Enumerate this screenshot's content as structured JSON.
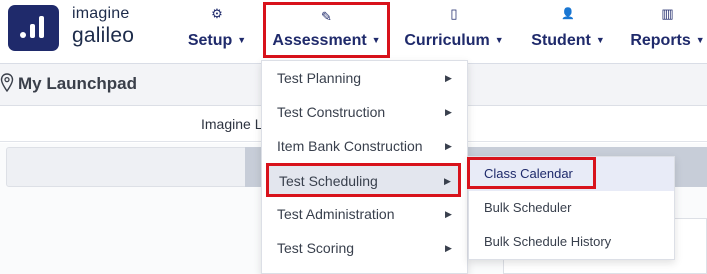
{
  "brand": {
    "line1": "imagine",
    "line2": "galileo",
    "logo_icon": "galileo-logo-icon",
    "logo_color": "#1f2a6b"
  },
  "nav": [
    {
      "label": "Setup",
      "icon": "gear-icon",
      "glyph": "⚙",
      "highlighted": false
    },
    {
      "label": "Assessment",
      "icon": "pencil-edit-icon",
      "glyph": "✎",
      "highlighted": true
    },
    {
      "label": "Curriculum",
      "icon": "book-icon",
      "glyph": "▯",
      "highlighted": false
    },
    {
      "label": "Student",
      "icon": "person-icon",
      "glyph": "👤",
      "highlighted": false
    },
    {
      "label": "Reports",
      "icon": "bar-chart-icon",
      "glyph": "▥",
      "highlighted": false
    }
  ],
  "caret_glyph": "▼",
  "launchpad": {
    "title": "My Launchpad",
    "icon": "map-pin-icon"
  },
  "subtab": {
    "label": "Imagine L"
  },
  "assessment_menu": [
    {
      "label": "Test Planning",
      "has_submenu": true,
      "active": false
    },
    {
      "label": "Test Construction",
      "has_submenu": true,
      "active": false
    },
    {
      "label": "Item Bank Construction",
      "has_submenu": true,
      "active": false
    },
    {
      "label": "Test Scheduling",
      "has_submenu": true,
      "active": true
    },
    {
      "label": "Test Administration",
      "has_submenu": true,
      "active": false
    },
    {
      "label": "Test Scoring",
      "has_submenu": true,
      "active": false
    }
  ],
  "submenu_arrow_glyph": "▶",
  "test_scheduling_submenu": [
    {
      "label": "Class Calendar",
      "active": true
    },
    {
      "label": "Bulk Scheduler",
      "active": false
    },
    {
      "label": "Bulk Schedule History",
      "active": false
    }
  ],
  "colors": {
    "brand_navy": "#1f2a6b",
    "highlight_red": "#d8121b",
    "active_menu_bg": "#e3e6ee"
  }
}
